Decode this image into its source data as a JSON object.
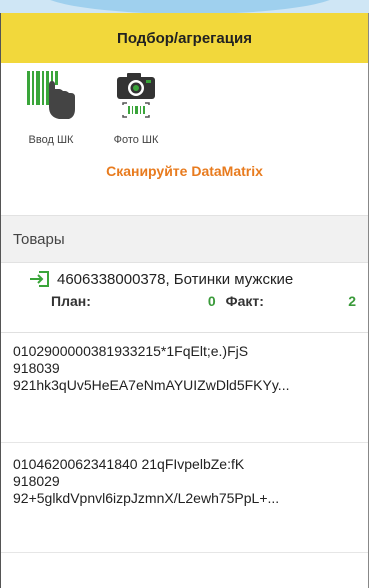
{
  "header": {
    "title": "Подбор/агрегация"
  },
  "toolbar": {
    "barcode_label": "Ввод ШК",
    "photo_label": "Фото ШК"
  },
  "scan_hint": "Сканируйте DataMatrix",
  "section": {
    "title": "Товары"
  },
  "product": {
    "name": "4606338000378, Ботинки мужские",
    "plan_label": "План:",
    "plan_value": "0",
    "fact_label": "Факт:",
    "fact_value": "2"
  },
  "codes": [
    {
      "line1": "0102900000381933215*1FqElt;e.)FjS",
      "line2": "918039",
      "line3": "921hk3qUv5HeEA7eNmAYUIZwDld5FKYy..."
    },
    {
      "line1": "0104620062341840 21qFIvpelbZe:fK",
      "line2": "918029",
      "line3": "92+5glkdVpnvl6izpJzmnX/L2ewh75PpL+..."
    }
  ],
  "colors": {
    "header_bg": "#f2d83b",
    "accent_orange": "#e87b1e",
    "green": "#3a9a3a"
  },
  "icons": [
    "barcode-hand-icon",
    "camera-barcode-icon",
    "enter-arrow-icon"
  ]
}
